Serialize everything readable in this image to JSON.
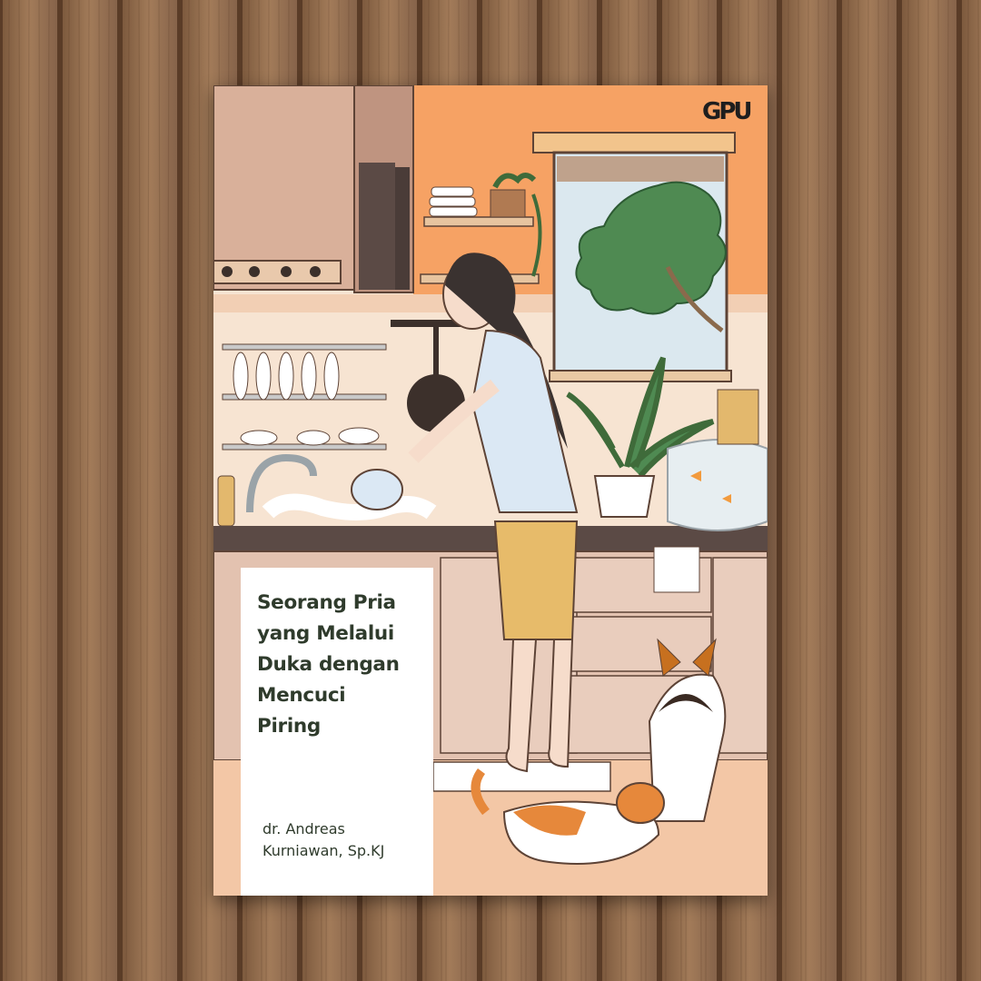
{
  "photo": {
    "background": "wooden-plank-wall",
    "colors": {
      "wood_dark": "#6b4a31",
      "wood_light": "#a98362",
      "cover_orange": "#f5a064",
      "title_text": "#2f3b2c"
    }
  },
  "book": {
    "publisher_logo": "GPU",
    "title": "Seorang Pria\nyang Melalui\nDuka dengan\nMencuci\nPiring",
    "author": "dr. Andreas\nKurniawan, Sp.KJ"
  }
}
